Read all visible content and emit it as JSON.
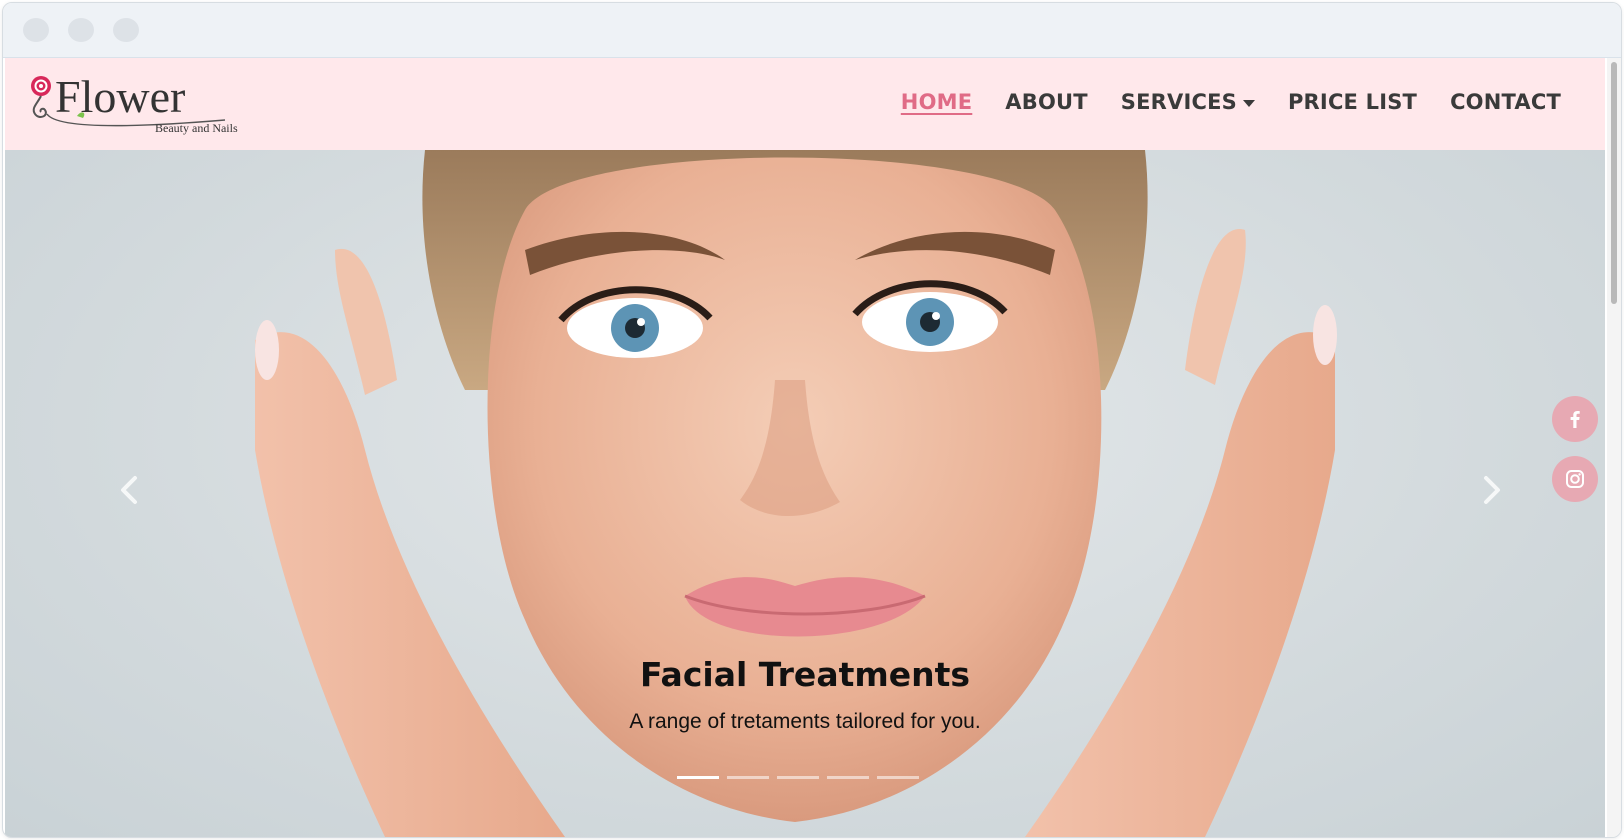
{
  "brand": {
    "name": "Flower",
    "tagline": "Beauty and Nails"
  },
  "nav": {
    "items": [
      {
        "label": "HOME",
        "active": true
      },
      {
        "label": "ABOUT",
        "active": false
      },
      {
        "label": "SERVICES",
        "active": false,
        "has_dropdown": true
      },
      {
        "label": "PRICE LIST",
        "active": false
      },
      {
        "label": "CONTACT",
        "active": false
      }
    ]
  },
  "hero": {
    "title": "Facial Treatments",
    "subtitle": "A range of tretaments tailored for you.",
    "slide_count": 5,
    "active_slide": 1
  },
  "social": {
    "icons": [
      "facebook-icon",
      "instagram-icon"
    ]
  },
  "colors": {
    "nav_background": "#ffe8eb",
    "active_link": "#e06b86",
    "social_button": "#e7a9b3",
    "logo_rose": "#d8285a"
  }
}
